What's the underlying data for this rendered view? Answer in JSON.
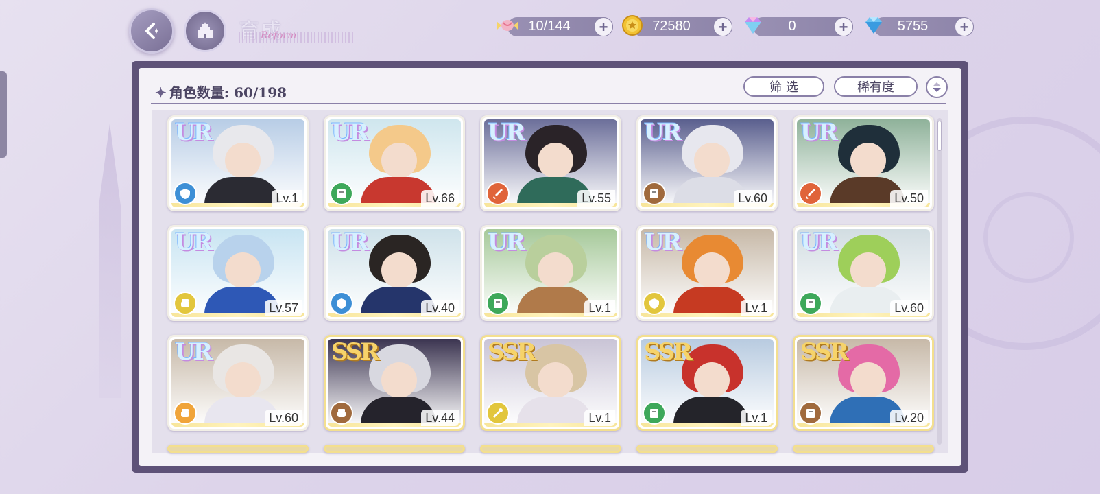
{
  "header": {
    "title": "育成",
    "title_script": "Reform",
    "back_icon": "back-arrow-icon",
    "home_icon": "castle-icon"
  },
  "resources": [
    {
      "name": "candy",
      "icon": "candy-icon",
      "value": "10/144"
    },
    {
      "name": "gold",
      "icon": "gold-coin-icon",
      "value": "72580"
    },
    {
      "name": "rainbow-gem",
      "icon": "rainbow-diamond-icon",
      "value": "0"
    },
    {
      "name": "blue-gem",
      "icon": "blue-diamond-icon",
      "value": "5755"
    }
  ],
  "panel": {
    "count_label": "角色数量: 60/198",
    "filter_label": "筛 选",
    "sort_label": "稀有度"
  },
  "colors": {
    "frame": "#5e5278",
    "ur_text": "#d6f0ff",
    "ssr_text": "#f6d36a"
  },
  "cards": [
    {
      "rarity": "UR",
      "level": "Lv.1",
      "element": "shield",
      "elem_color": "#3d8fd6",
      "sky": "#b8cde6",
      "hair": "#e8e8ec",
      "body": "#2b2b33"
    },
    {
      "rarity": "UR",
      "level": "Lv.66",
      "element": "book",
      "elem_color": "#3ea85a",
      "sky": "#cfe6ee",
      "hair": "#f4c98a",
      "body": "#c8382f"
    },
    {
      "rarity": "UR",
      "level": "Lv.55",
      "element": "sword",
      "elem_color": "#e0643a",
      "sky": "#6c6f9a",
      "hair": "#2a2328",
      "body": "#2f6b5a"
    },
    {
      "rarity": "UR",
      "level": "Lv.60",
      "element": "book",
      "elem_color": "#a06a3d",
      "sky": "#5a5f8e",
      "hair": "#e7e7ee",
      "body": "#dcdde6"
    },
    {
      "rarity": "UR",
      "level": "Lv.50",
      "element": "sword",
      "elem_color": "#e0643a",
      "sky": "#8fb29a",
      "hair": "#1f2f3a",
      "body": "#5a3a28"
    },
    {
      "rarity": "UR",
      "level": "Lv.57",
      "element": "fist",
      "elem_color": "#e2c63d",
      "sky": "#c8e4f2",
      "hair": "#b8d2ec",
      "body": "#2e58b6"
    },
    {
      "rarity": "UR",
      "level": "Lv.40",
      "element": "shield",
      "elem_color": "#3d8fd6",
      "sky": "#cfe2ea",
      "hair": "#2a2523",
      "body": "#25356b"
    },
    {
      "rarity": "UR",
      "level": "Lv.1",
      "element": "book",
      "elem_color": "#3ea85a",
      "sky": "#a6c99a",
      "hair": "#b9cf9c",
      "body": "#b07a4a"
    },
    {
      "rarity": "UR",
      "level": "Lv.1",
      "element": "shield",
      "elem_color": "#e2c63d",
      "sky": "#c7b9a8",
      "hair": "#e88a33",
      "body": "#c63a22"
    },
    {
      "rarity": "UR",
      "level": "Lv.60",
      "element": "book",
      "elem_color": "#3ea85a",
      "sky": "#d2dde2",
      "hair": "#9ecf5a",
      "body": "#e9eef0"
    },
    {
      "rarity": "UR",
      "level": "Lv.60",
      "element": "fist",
      "elem_color": "#f0a43a",
      "sky": "#c7b9a8",
      "hair": "#e9e6e4",
      "body": "#e8e6ef"
    },
    {
      "rarity": "SSR",
      "level": "Lv.44",
      "element": "fist",
      "elem_color": "#a06a3d",
      "sky": "#3b3450",
      "hair": "#d8d8e0",
      "body": "#25232c"
    },
    {
      "rarity": "SSR",
      "level": "Lv.1",
      "element": "wand",
      "elem_color": "#e2c63d",
      "sky": "#c9c4d6",
      "hair": "#d8c5a4",
      "body": "#e6e1ea"
    },
    {
      "rarity": "SSR",
      "level": "Lv.1",
      "element": "book",
      "elem_color": "#3ea85a",
      "sky": "#b8cbe0",
      "hair": "#c8322c",
      "body": "#24242a"
    },
    {
      "rarity": "SSR",
      "level": "Lv.20",
      "element": "book",
      "elem_color": "#a06a3d",
      "sky": "#c7b9a8",
      "hair": "#e46aa6",
      "body": "#2f6fb6"
    }
  ]
}
